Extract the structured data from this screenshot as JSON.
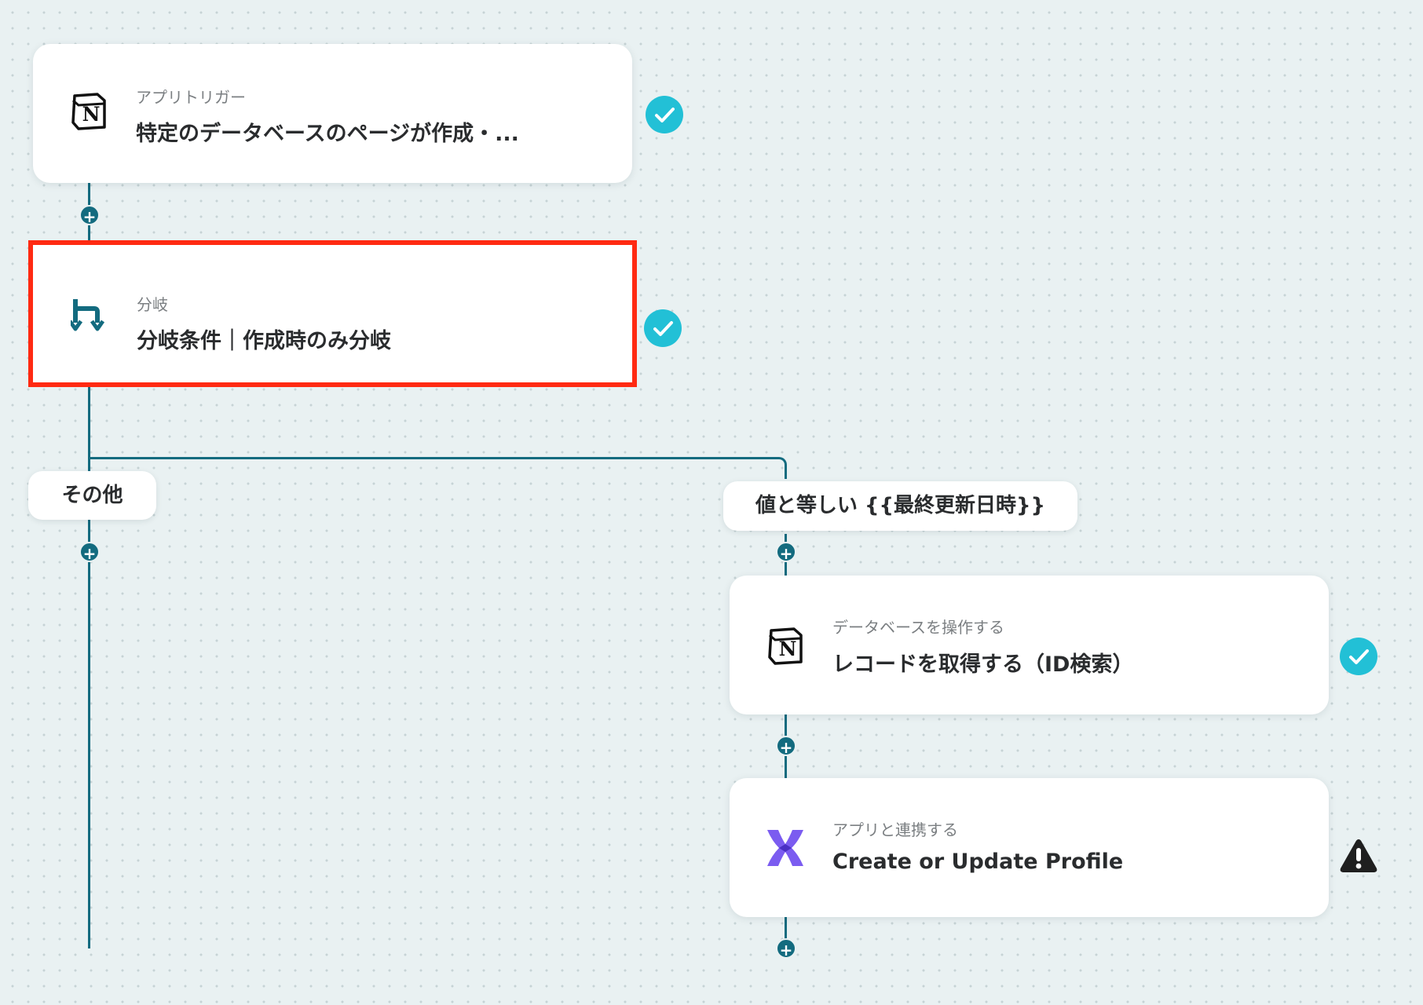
{
  "flow": {
    "trigger": {
      "type_label": "アプリトリガー",
      "title": "特定のデータベースのページが作成・...",
      "app_icon": "notion-icon",
      "status": "complete"
    },
    "branch": {
      "type_label": "分岐",
      "title": "分岐条件｜作成時のみ分岐",
      "app_icon": "branch-icon",
      "status": "complete",
      "selected": true
    },
    "branches": {
      "other_label": "その他",
      "condition_label": "値と等しい {{最終更新日時}}"
    },
    "db_step": {
      "type_label": "データベースを操作する",
      "title": "レコードを取得する（ID検索）",
      "app_icon": "notion-icon",
      "status": "complete"
    },
    "app_step": {
      "type_label": "アプリと連携する",
      "title": "Create or Update Profile",
      "app_icon": "klaviyo-x-icon",
      "status": "warning"
    },
    "add_step_symbol": "+"
  },
  "colors": {
    "connector": "#136b7f",
    "check": "#22c0d6",
    "selection": "#ff2a12",
    "accent_purple": "#7b5cf0",
    "warning": "#1f1f1f"
  }
}
